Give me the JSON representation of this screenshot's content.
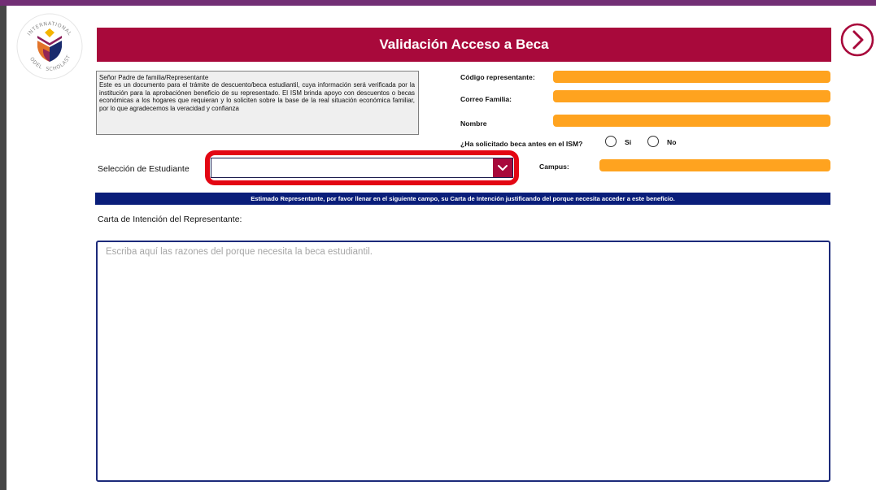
{
  "header": {
    "title": "Validación Acceso a Beca"
  },
  "logo": {
    "arc_text_top": "INTERNATIONAL",
    "arc_text_right": "SCHOLASTIC",
    "arc_text_left": "MODEL",
    "colors": [
      "#8b1e5a",
      "#f4b400",
      "#1a2b6d",
      "#e2742a"
    ]
  },
  "notice": {
    "title": "Señor Padre de familia/Representante",
    "body": "Este es un documento para el trámite de descuento/beca estudiantil, cuya información será verificada por la institución para la aprobaciónen beneficio de su representado. El ISM brinda apoyo con descuentos o becas económicas a los hogares que requieran y lo soliciten sobre la base de la real situación económica familiar, por lo que agradecemos la veracidad y confianza"
  },
  "fields": {
    "codigo_label": "Código representante:",
    "correo_label": "Correo Familia:",
    "nombre_label": "Nombre",
    "codigo_value": "",
    "correo_value": "",
    "nombre_value": "",
    "field_color": "#ffa31f"
  },
  "beca_question": {
    "label": "¿Ha solicitado beca antes en el ISM?",
    "options": [
      "Si",
      "No"
    ]
  },
  "student_select": {
    "label": "Selección de Estudiante",
    "selected_value": "",
    "highlight_color": "#e30613"
  },
  "campus": {
    "label": "Campus:",
    "value": ""
  },
  "banner": {
    "text": "Estimado Representante, por favor llenar en el siguiente campo, su Carta de Intención justificando del porque necesita acceder a este beneficio."
  },
  "carta": {
    "label": "Carta de Intención del Representante:",
    "placeholder": "Escriba aquí las razones del porque necesita la beca estudiantil."
  },
  "colors": {
    "brand_red": "#a8093b",
    "banner_blue": "#0a1e7a",
    "top_bar": "#722f75"
  },
  "icons": {
    "next": "chevron-right-circle-icon",
    "dropdown": "chevron-down-icon"
  }
}
